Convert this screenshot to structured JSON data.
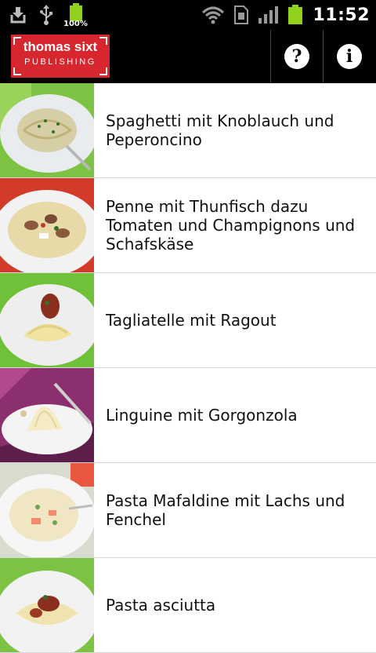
{
  "status_bar": {
    "battery_small_label": "100%",
    "time": "11:52",
    "icons": [
      "download-icon",
      "usb-icon",
      "battery-full-icon",
      "wifi-icon",
      "sim-card-icon",
      "signal-strength-icon",
      "battery-icon"
    ]
  },
  "action_bar": {
    "logo": {
      "line1": "thomas sixt",
      "line2": "PUBLISHING"
    },
    "help_icon": "help-icon",
    "info_icon": "info-icon"
  },
  "colors": {
    "logo_red": "#d7262e",
    "bar_black": "#000000",
    "battery_green": "#8fd11c",
    "divider": "#d8d8d8"
  },
  "recipes": [
    {
      "title": "Spaghetti mit Knoblauch und Peperoncino"
    },
    {
      "title": "Penne mit Thunfisch dazu Tomaten und Champignons und Schafskäse"
    },
    {
      "title": "Tagliatelle mit Ragout"
    },
    {
      "title": "Linguine mit Gorgonzola"
    },
    {
      "title": "Pasta Mafaldine mit Lachs und Fenchel"
    },
    {
      "title": "Pasta asciutta"
    }
  ]
}
